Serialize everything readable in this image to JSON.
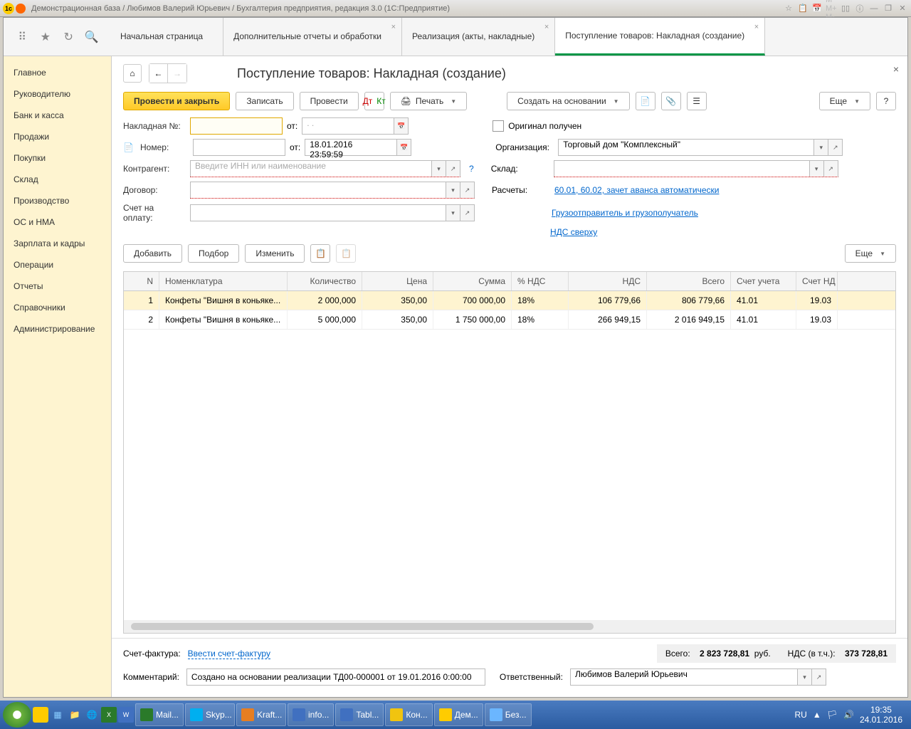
{
  "titlebar": "Демонстрационная база / Любимов Валерий Юрьевич / Бухгалтерия предприятия, редакция 3.0  (1С:Предприятие)",
  "tabs": [
    {
      "label": "Начальная страница"
    },
    {
      "label": "Дополнительные отчеты и обработки"
    },
    {
      "label": "Реализация (акты, накладные)"
    },
    {
      "label": "Поступление товаров: Накладная (создание)"
    }
  ],
  "sidebar": [
    "Главное",
    "Руководителю",
    "Банк и касса",
    "Продажи",
    "Покупки",
    "Склад",
    "Производство",
    "ОС и НМА",
    "Зарплата и кадры",
    "Операции",
    "Отчеты",
    "Справочники",
    "Администрирование"
  ],
  "header_title": "Поступление товаров: Накладная (создание)",
  "btns": {
    "post_close": "Провести и закрыть",
    "save": "Записать",
    "post": "Провести",
    "print": "Печать",
    "create_based": "Создать на основании",
    "more": "Еще"
  },
  "form": {
    "invoice_label": "Накладная №:",
    "from": "от:",
    "number_label": "Номер:",
    "date": "18.01.2016 23:59:59",
    "original": "Оригинал получен",
    "org_label": "Организация:",
    "org": "Торговый дом \"Комплексный\"",
    "contragent_label": "Контрагент:",
    "contragent_ph": "Введите ИНН или наименование",
    "warehouse_label": "Склад:",
    "contract_label": "Договор:",
    "settlements_label": "Расчеты:",
    "settlements_link": "60.01, 60.02, зачет аванса автоматически",
    "payment_invoice_label": "Счет на оплату:",
    "shipper_link": "Грузоотправитель и грузополучатель",
    "vat_link": "НДС сверху"
  },
  "table_btns": {
    "add": "Добавить",
    "select": "Подбор",
    "edit": "Изменить",
    "more": "Еще"
  },
  "columns": [
    "N",
    "Номенклатура",
    "Количество",
    "Цена",
    "Сумма",
    "% НДС",
    "НДС",
    "Всего",
    "Счет учета",
    "Счет НД"
  ],
  "rows": [
    {
      "n": "1",
      "nom": "Конфеты \"Вишня в коньяке...",
      "qty": "2 000,000",
      "price": "350,00",
      "sum": "700 000,00",
      "pct": "18%",
      "vat": "106 779,66",
      "total": "806 779,66",
      "acc": "41.01",
      "acc2": "19.03"
    },
    {
      "n": "2",
      "nom": "Конфеты \"Вишня в коньяке...",
      "qty": "5 000,000",
      "price": "350,00",
      "sum": "1 750 000,00",
      "pct": "18%",
      "vat": "266 949,15",
      "total": "2 016 949,15",
      "acc": "41.01",
      "acc2": "19.03"
    }
  ],
  "footer": {
    "sf_label": "Счет-фактура:",
    "sf_link": "Ввести счет-фактуру",
    "total_label": "Всего:",
    "total": "2 823 728,81",
    "cur": "руб.",
    "vat_label": "НДС (в т.ч.):",
    "vat": "373 728,81",
    "comment_label": "Комментарий:",
    "comment": "Создано на основании реализации ТД00-000001 от 19.01.2016 0:00:00",
    "resp_label": "Ответственный:",
    "resp": "Любимов Валерий Юрьевич"
  },
  "taskbar": [
    "Mail...",
    "Skyp...",
    "Kraft...",
    "info...",
    "Tabl...",
    "Кон...",
    "Дем...",
    "Без..."
  ],
  "tray": {
    "lang": "RU",
    "time": "19:35",
    "date": "24.01.2016"
  }
}
